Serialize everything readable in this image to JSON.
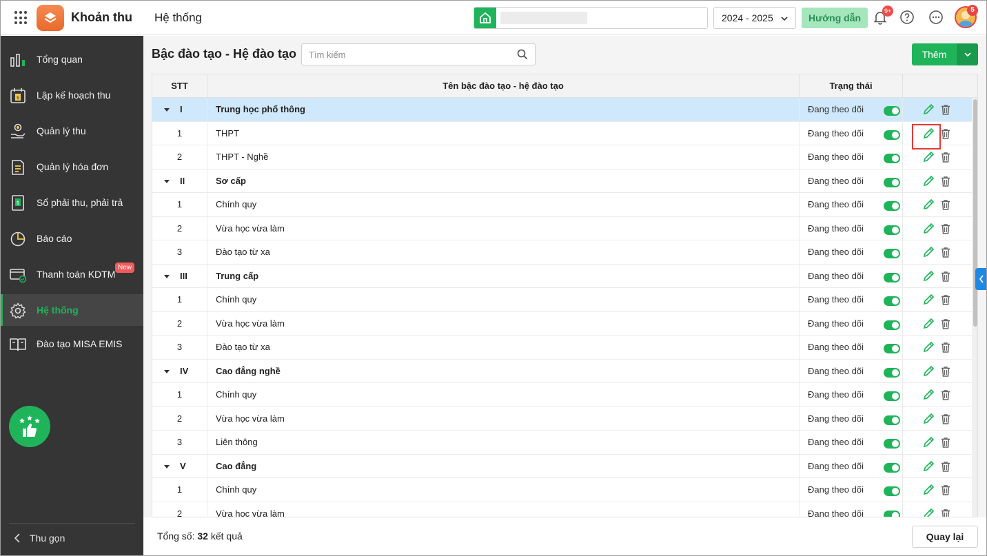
{
  "app": {
    "title": "Khoản thu",
    "module": "Hệ thống",
    "year": "2024 - 2025",
    "guide_label": "Hướng dẫn",
    "notification_count": "9+",
    "avatar_badge": "5"
  },
  "sidebar": {
    "items": [
      {
        "label": "Tổng quan",
        "icon": "chart-bars-icon"
      },
      {
        "label": "Lập kế hoạch thu",
        "icon": "calendar-money-icon"
      },
      {
        "label": "Quản lý thu",
        "icon": "hand-coin-icon"
      },
      {
        "label": "Quản lý hóa đơn",
        "icon": "invoice-icon"
      },
      {
        "label": "Sổ phải thu, phải trả",
        "icon": "ledger-icon"
      },
      {
        "label": "Báo cáo",
        "icon": "pie-chart-icon"
      },
      {
        "label": "Thanh toán KDTM",
        "icon": "card-payment-icon"
      },
      {
        "label": "Hệ thống",
        "icon": "gear-icon"
      },
      {
        "label": "Đào tạo MISA EMIS",
        "icon": "book-icon"
      }
    ],
    "new_badge": "New",
    "active_index": 7,
    "collapse_label": "Thu gọn"
  },
  "page": {
    "title": "Bậc đào tạo - Hệ đào tạo",
    "search_placeholder": "Tìm kiếm",
    "add_label": "Thêm",
    "back_label": "Quay lại",
    "total_prefix": "Tổng số:",
    "total_count": "32",
    "total_suffix": "kết quả"
  },
  "table": {
    "columns": [
      "STT",
      "Tên bậc đào tạo - hệ đào tạo",
      "Trạng thái"
    ],
    "rows": [
      {
        "stt": "I",
        "name": "Trung học phổ thông",
        "status": "Đang theo dõi",
        "group": true,
        "selected": true
      },
      {
        "stt": "1",
        "name": "THPT",
        "status": "Đang theo dõi",
        "group": false
      },
      {
        "stt": "2",
        "name": "THPT - Nghề",
        "status": "Đang theo dõi",
        "group": false
      },
      {
        "stt": "II",
        "name": "Sơ cấp",
        "status": "Đang theo dõi",
        "group": true
      },
      {
        "stt": "1",
        "name": "Chính quy",
        "status": "Đang theo dõi",
        "group": false
      },
      {
        "stt": "2",
        "name": "Vừa học vừa làm",
        "status": "Đang theo dõi",
        "group": false
      },
      {
        "stt": "3",
        "name": "Đào tạo từ xa",
        "status": "Đang theo dõi",
        "group": false
      },
      {
        "stt": "III",
        "name": "Trung cấp",
        "status": "Đang theo dõi",
        "group": true
      },
      {
        "stt": "1",
        "name": "Chính quy",
        "status": "Đang theo dõi",
        "group": false
      },
      {
        "stt": "2",
        "name": "Vừa học vừa làm",
        "status": "Đang theo dõi",
        "group": false
      },
      {
        "stt": "3",
        "name": "Đào tạo từ xa",
        "status": "Đang theo dõi",
        "group": false
      },
      {
        "stt": "IV",
        "name": "Cao đẳng nghề",
        "status": "Đang theo dõi",
        "group": true
      },
      {
        "stt": "1",
        "name": "Chính quy",
        "status": "Đang theo dõi",
        "group": false
      },
      {
        "stt": "2",
        "name": "Vừa học vừa làm",
        "status": "Đang theo dõi",
        "group": false
      },
      {
        "stt": "3",
        "name": "Liên thông",
        "status": "Đang theo dõi",
        "group": false
      },
      {
        "stt": "V",
        "name": "Cao đẳng",
        "status": "Đang theo dõi",
        "group": true
      },
      {
        "stt": "1",
        "name": "Chính quy",
        "status": "Đang theo dõi",
        "group": false
      },
      {
        "stt": "2",
        "name": "Vừa học vừa làm",
        "status": "Đang theo dõi",
        "group": false
      }
    ]
  },
  "colors": {
    "accent": "#1fb45a",
    "sidebar_bg": "#353535",
    "selected_row": "#cfe8fb",
    "highlight_box": "#e53935"
  }
}
